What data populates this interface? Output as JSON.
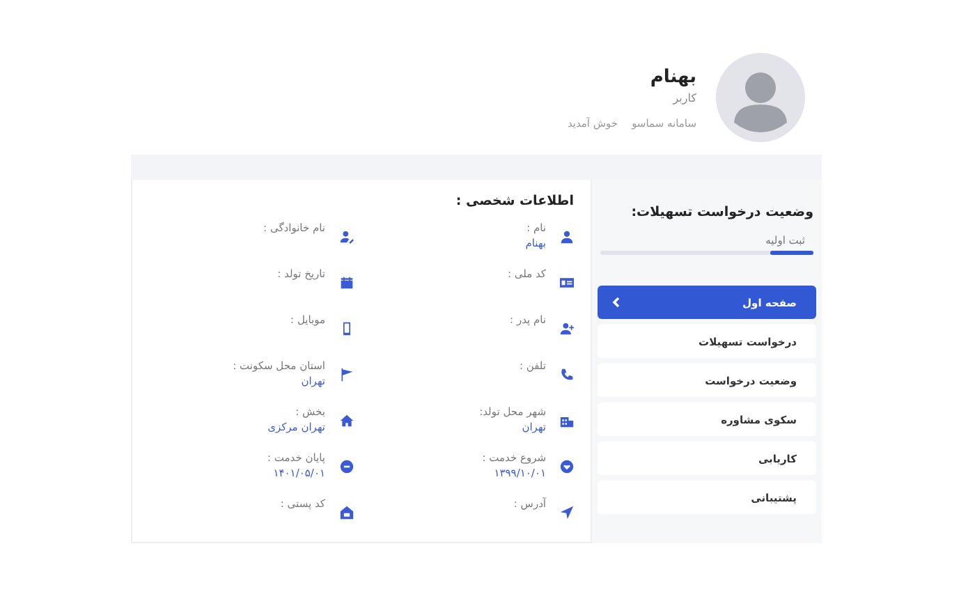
{
  "header": {
    "name": "بهنام",
    "role": "کاربر",
    "breadcrumb": [
      "سامانه سماسو",
      "خوش آمدید"
    ]
  },
  "sidebar": {
    "title": "وضعیت درخواست تسهیلات:",
    "progress": {
      "label": "ثبت اولیه",
      "level": 0.2
    },
    "items": [
      {
        "label": "صفحه اول",
        "selected": true
      },
      {
        "label": "درخواست تسهیلات",
        "selected": false
      },
      {
        "label": "وضعیت درخواست",
        "selected": false
      },
      {
        "label": "سکوی مشاوره",
        "selected": false
      },
      {
        "label": "کاریابی",
        "selected": false
      },
      {
        "label": "پشتیبانی",
        "selected": false
      }
    ]
  },
  "personal_info": {
    "title": "اطلاعات شخصی :",
    "fields": [
      {
        "label": "نام :",
        "value": "بهنام"
      },
      {
        "label": "نام خانوادگی :"
      },
      {
        "label": "کد ملی :"
      },
      {
        "label": "تاریخ تولد :"
      },
      {
        "label": "نام پدر :"
      },
      {
        "label": "موبایل :"
      },
      {
        "label": "تلفن :"
      },
      {
        "label": "استان محل سکونت :",
        "value": "تهران"
      },
      {
        "label": "شهر محل تولد:",
        "value": "تهران"
      },
      {
        "label": "بخش :",
        "value": "تهران مرکزی"
      },
      {
        "label": "شروع خدمت :",
        "value": "۱۳۹۹/۱۰/۰۱"
      },
      {
        "label": "پایان خدمت :",
        "value": "۱۴۰۱/۰۵/۰۱"
      },
      {
        "label": "آدرس :"
      },
      {
        "label": "کد پستی :"
      }
    ]
  }
}
